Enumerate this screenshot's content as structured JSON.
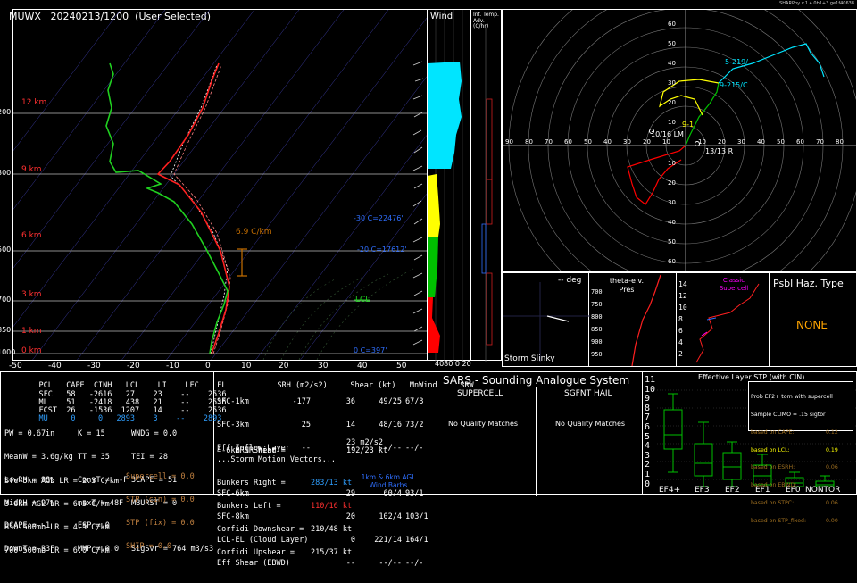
{
  "header": {
    "station": "MUWX",
    "datetime": "20240213/1200",
    "mode": "(User Selected)",
    "version": "SHARPpy v.1.4.0b1+3.ge1f40638"
  },
  "skewt": {
    "height_labels": [
      "12 km",
      "9 km",
      "6 km",
      "3 km",
      "1 km",
      "0 km"
    ],
    "pressure_labels": [
      "200",
      "300",
      "500",
      "700",
      "850",
      "1000"
    ],
    "temp_labels": [
      "-50",
      "-40",
      "-30",
      "-20",
      "-10",
      "0",
      "10",
      "20",
      "30",
      "40",
      "50"
    ],
    "lapse_label": "6.9 C/km",
    "iso_labels": [
      "-30 C=22476'",
      "-20 C=17612'",
      "0 C=397'"
    ],
    "lcl_label": "LCL"
  },
  "wind_panel": {
    "title": "Wind",
    "sub": "Inf. Temp. Adv. (C/hr)",
    "bottom": "4080 0 20"
  },
  "hodograph": {
    "rings": [
      "10",
      "20",
      "30",
      "40",
      "50",
      "60",
      "70",
      "80",
      "90"
    ],
    "labels": [
      "10/16 LM",
      "13/13 R",
      "5-219/",
      "9-215/C",
      "9-1"
    ]
  },
  "insets": {
    "deg_title": "-- deg",
    "theta_label": "theta-e v. Pres",
    "height_ticks": [
      "14",
      "12",
      "10",
      "8",
      "6",
      "4",
      "2"
    ],
    "pres_ticks": [
      "700",
      "750",
      "800",
      "850",
      "900",
      "950"
    ],
    "storm_label": "Storm Slinky",
    "classic": "Classic Supercell"
  },
  "psbl": {
    "title": "Psbl Haz. Type",
    "value": "NONE"
  },
  "thermo": {
    "headers": [
      "PCL",
      "CAPE",
      "CINH",
      "LCL",
      "LI",
      "LFC",
      "EL"
    ],
    "rows": [
      [
        "SFC",
        "58",
        "-2616",
        "27",
        "23",
        "--",
        "2536"
      ],
      [
        "ML",
        "51",
        "-2418",
        "438",
        "21",
        "--",
        "2536"
      ],
      [
        "FCST",
        "26",
        "-1536",
        "1207",
        "14",
        "--",
        "2536"
      ],
      [
        "MU",
        "0",
        "0",
        "2893",
        "3",
        "--",
        "2893"
      ]
    ],
    "indices_left": [
      "PW = 0.67in",
      "MeanW = 3.6g/kg",
      "LowRH = 98%",
      "MidRH = 97%",
      "DCAPE = -1",
      "DownT = 33F"
    ],
    "indices_mid": [
      "K = 15",
      "TT = 35",
      "ConvT = --F",
      "maxT = 48F",
      "ESP = 0",
      "MMP = 0.0"
    ],
    "indices_right": [
      "WNDG = 0.0",
      "TEI = 28",
      "3CAPE = 51",
      "MBURST = 0",
      "",
      "SigSvr = 764 m3/s3"
    ],
    "lapse": [
      "Sfc-3km AGL LR = 2.3 C/km",
      "3-6km AGL LR = 6.5 C/km",
      "850-500mb LR = 4.5 C/km",
      "700-500mb LR = 6.0 C/km"
    ],
    "params": [
      "Supercell = 0.0",
      "STP (cin) = 0.0",
      "STP (fix) = 0.0",
      "SHIP = 0.0"
    ]
  },
  "kinematic": {
    "headers": [
      "SRH (m2/s2)",
      "Shear (kt)",
      "MnWind",
      "SRW"
    ],
    "rows": [
      [
        "SFC-1km",
        "-177",
        "36",
        "49/25",
        "67/3"
      ],
      [
        "SFC-3km",
        "25",
        "14",
        "48/16",
        "73/2"
      ],
      [
        "Eff Inflow Layer",
        "--",
        "--",
        "--/--",
        "--/-"
      ],
      [
        "",
        "",
        "",
        "",
        ""
      ],
      [
        "SFC-6km",
        "",
        "29",
        "60/4",
        "93/1"
      ],
      [
        "SFC-8km",
        "",
        "20",
        "102/4",
        "103/1"
      ],
      [
        "LCL-EL (Cloud Layer)",
        "",
        "0",
        "221/14",
        "164/1"
      ],
      [
        "Eff Shear (EBWD)",
        "",
        "--",
        "--/--",
        "--/-"
      ]
    ],
    "brn": [
      "BRN Shear =",
      "23 m2/s2"
    ],
    "srwind": [
      "4-6km SR Wind =",
      "192/23 kt"
    ],
    "vectors_title": "...Storm Motion Vectors...",
    "vectors": [
      [
        "Bunkers Right =",
        "283/13 kt"
      ],
      [
        "Bunkers Left =",
        "110/16 kt"
      ],
      [
        "Corfidi Downshear =",
        "210/48 kt"
      ],
      [
        "Corfidi Upshear =",
        "215/37 kt"
      ]
    ],
    "barb_legend": "1km & 6km AGL Wind Barbs"
  },
  "sars": {
    "title": "SARS - Sounding Analogue System",
    "left_title": "SUPERCELL",
    "right_title": "SGFNT HAIL",
    "left_value": "No Quality Matches",
    "right_value": "No Quality Matches"
  },
  "stp": {
    "title": "Effective Layer STP (with CIN)",
    "yticks": [
      "11",
      "10",
      "9",
      "8",
      "7",
      "6",
      "5",
      "4",
      "3",
      "2",
      "1",
      "0"
    ],
    "xlabels": [
      "EF4+",
      "EF3",
      "EF2",
      "EF1",
      "EF0",
      "NONTOR"
    ],
    "legend": [
      "Prob EF2+ torn with supercell",
      "Sample CLIMO = .15 sigtor",
      "based on CAPE:",
      "based on LCL:",
      "based on ESRH:",
      "based on EBWD:",
      "based on STPC:",
      "based on STP_fixed:"
    ],
    "legend_vals": [
      "",
      "",
      "0.12",
      "0.19",
      "0.06",
      "",
      "0.06",
      "0.00"
    ]
  },
  "colors": {
    "temp": "#ff2020",
    "dew": "#20d020",
    "cyan": "#00e5ff",
    "yellow": "#ffff00",
    "green": "#00c000",
    "red": "#ff0000",
    "orange": "#ffa500",
    "magenta": "#ff00ff",
    "blue": "#2f6fff"
  }
}
